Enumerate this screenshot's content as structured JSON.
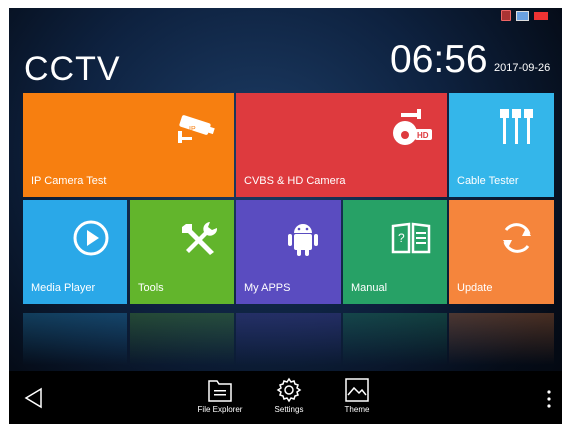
{
  "header": {
    "title": "CCTV",
    "time": "06:56",
    "date": "2017-09-26"
  },
  "tiles": [
    {
      "label": "IP Camera Test",
      "color": "#f77f10",
      "icon": "ip-camera-icon"
    },
    {
      "label": "CVBS & HD Camera",
      "color": "#de3a3e",
      "icon": "hd-dome-camera-icon"
    },
    {
      "label": "Cable Tester",
      "color": "#34b6ea",
      "icon": "cable-connectors-icon"
    },
    {
      "label": "Media Player",
      "color": "#2aa8e8",
      "icon": "play-icon"
    },
    {
      "label": "Tools",
      "color": "#62b52c",
      "icon": "tools-icon"
    },
    {
      "label": "My APPS",
      "color": "#5a4cc0",
      "icon": "android-icon"
    },
    {
      "label": "Manual",
      "color": "#27a166",
      "icon": "book-icon"
    },
    {
      "label": "Update",
      "color": "#f5853c",
      "icon": "refresh-icon"
    }
  ],
  "tile_icon_texts": {
    "ip_badge": "IP",
    "hd_badge": "HD"
  },
  "dock": {
    "items": [
      {
        "label": "File Explorer",
        "icon": "folder-icon"
      },
      {
        "label": "Settings",
        "icon": "gear-icon"
      },
      {
        "label": "Theme",
        "icon": "theme-icon"
      }
    ],
    "back_icon": "back-triangle-icon",
    "more_icon": "more-vertical-icon"
  },
  "status_icons": [
    "sim-icon",
    "network-icon",
    "battery-icon"
  ]
}
